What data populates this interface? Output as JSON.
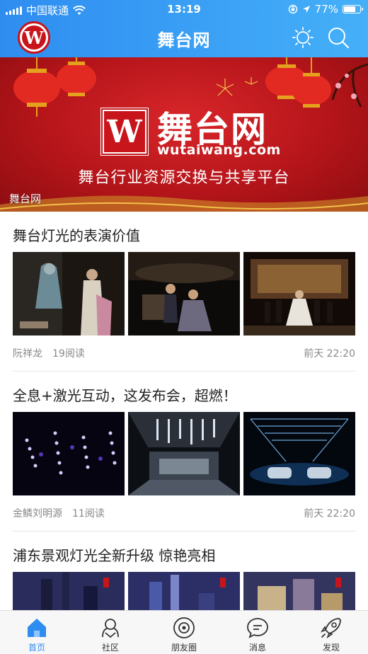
{
  "status_bar": {
    "carrier": "中国联通",
    "time": "13:19",
    "battery_percent": "77%",
    "battery_level": 0.77
  },
  "header": {
    "logo_letter": "W",
    "title": "舞台网"
  },
  "banner": {
    "logo_letter": "W",
    "brand_name": "舞台网",
    "brand_url": "wutaiwang.com",
    "slogan": "舞台行业资源交换与共享平台",
    "caption": "舞台网"
  },
  "articles": [
    {
      "title": "舞台灯光的表演价值",
      "author": "阮祥龙",
      "reads": "19阅读",
      "time": "前天 22:20"
    },
    {
      "title": "全息+激光互动，这发布会，超燃！",
      "author": "金鳞刘明源",
      "reads": "11阅读",
      "time": "前天 22:20"
    },
    {
      "title": "浦东景观灯光全新升级 惊艳亮相"
    }
  ],
  "tabs": [
    {
      "label": "首页",
      "icon": "home-icon",
      "active": true
    },
    {
      "label": "社区",
      "icon": "community-icon",
      "active": false
    },
    {
      "label": "朋友圈",
      "icon": "moments-icon",
      "active": false
    },
    {
      "label": "消息",
      "icon": "message-icon",
      "active": false
    },
    {
      "label": "发现",
      "icon": "rocket-icon",
      "active": false
    }
  ],
  "colors": {
    "accent": "#2f8df0",
    "brand_red": "#c8151b"
  }
}
